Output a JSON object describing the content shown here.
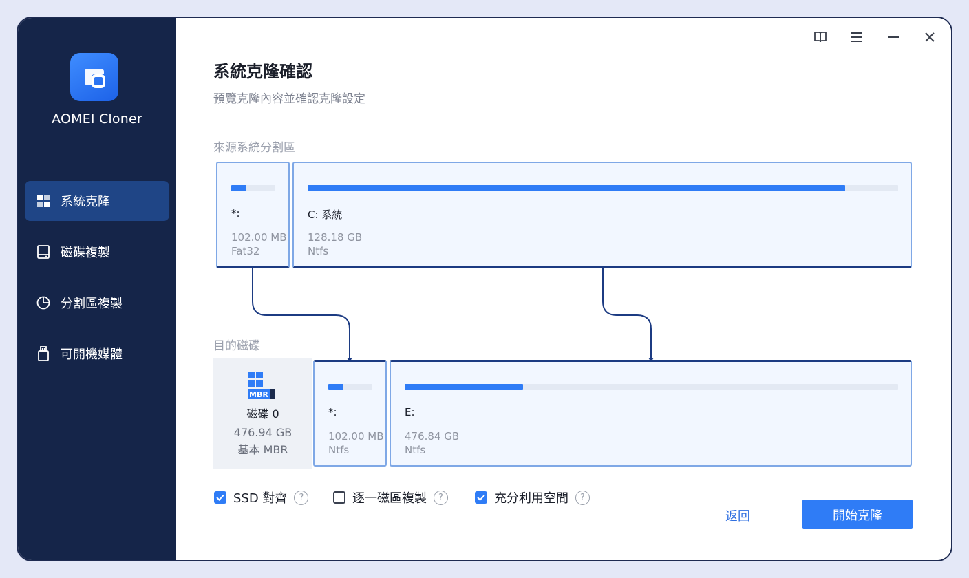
{
  "app": {
    "name": "AOMEI Cloner"
  },
  "sidebar": {
    "items": [
      {
        "label": "系統克隆",
        "icon": "windows-icon",
        "active": true
      },
      {
        "label": "磁碟複製",
        "icon": "disk-icon",
        "active": false
      },
      {
        "label": "分割區複製",
        "icon": "pie-chart-icon",
        "active": false
      },
      {
        "label": "可開機媒體",
        "icon": "usb-icon",
        "active": false
      }
    ]
  },
  "window_controls": [
    "book-icon",
    "menu-icon",
    "minimize-icon",
    "close-icon"
  ],
  "main": {
    "title": "系統克隆確認",
    "subtitle": "預覽克隆內容並確認克隆設定",
    "source_label": "來源系統分割區",
    "target_label": "目的磁碟",
    "source_partitions": [
      {
        "name": "*:",
        "size": "102.00 MB",
        "fs": "Fat32",
        "used_fraction": 0.35
      },
      {
        "name": "C: 系統",
        "size": "128.18 GB",
        "fs": "Ntfs",
        "used_fraction": 0.91
      }
    ],
    "target_disk": {
      "icon": "windows-disk-icon",
      "badge": "MBR",
      "name": "磁碟 0",
      "size": "476.94 GB",
      "type": "基本 MBR"
    },
    "target_partitions": [
      {
        "name": "*:",
        "size": "102.00 MB",
        "fs": "Ntfs",
        "used_fraction": 0.35
      },
      {
        "name": "E:",
        "size": "476.84 GB",
        "fs": "Ntfs",
        "used_fraction": 0.24
      }
    ]
  },
  "options": [
    {
      "label": "SSD 對齊",
      "checked": true,
      "help": "?"
    },
    {
      "label": "逐一磁區複製",
      "checked": false,
      "help": "?"
    },
    {
      "label": "充分利用空間",
      "checked": true,
      "help": "?"
    }
  ],
  "actions": {
    "back": "返回",
    "start": "開始克隆"
  },
  "colors": {
    "accent": "#2f7cf6",
    "sidebar": "#152549",
    "sidebar_active": "#1f4586",
    "connector": "#1c3b82"
  }
}
